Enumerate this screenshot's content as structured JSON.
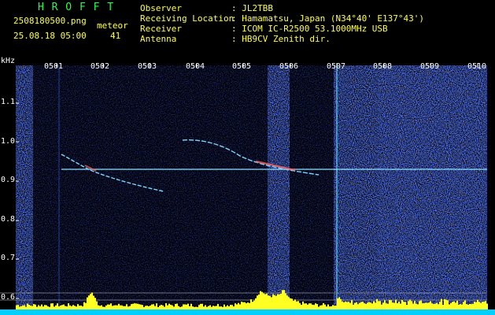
{
  "header": {
    "app_title": "H R O F F T",
    "filename": "2508180500.png",
    "datetime": "25.08.18 05:00",
    "event_label": "meteor",
    "event_count": "41",
    "info_labels": [
      "Observer",
      "Receiving Location",
      "Receiver",
      "Antenna"
    ],
    "info_values": [
      ": JL2TBB",
      ": Hamamatsu, Japan (N34°40' E137°43')",
      ": ICOM IC-R2500 53.1000MHz USB",
      ": HB9CV Zenith dir."
    ]
  },
  "axis": {
    "y_unit": "kHz",
    "y_ticks": [
      "1.1",
      "1.0",
      "0.9",
      "0.8",
      "0.7",
      "0.6"
    ],
    "x_ticks": [
      "0501",
      "0502",
      "0503",
      "0504",
      "0505",
      "0506",
      "0507",
      "0508",
      "0509",
      "0510"
    ]
  },
  "colors": {
    "background": "#000000",
    "noise": "#1a2a9a",
    "carrier": "#8fe0ff",
    "histogram": "#ffff22",
    "baseline": "#00d0ff"
  }
}
